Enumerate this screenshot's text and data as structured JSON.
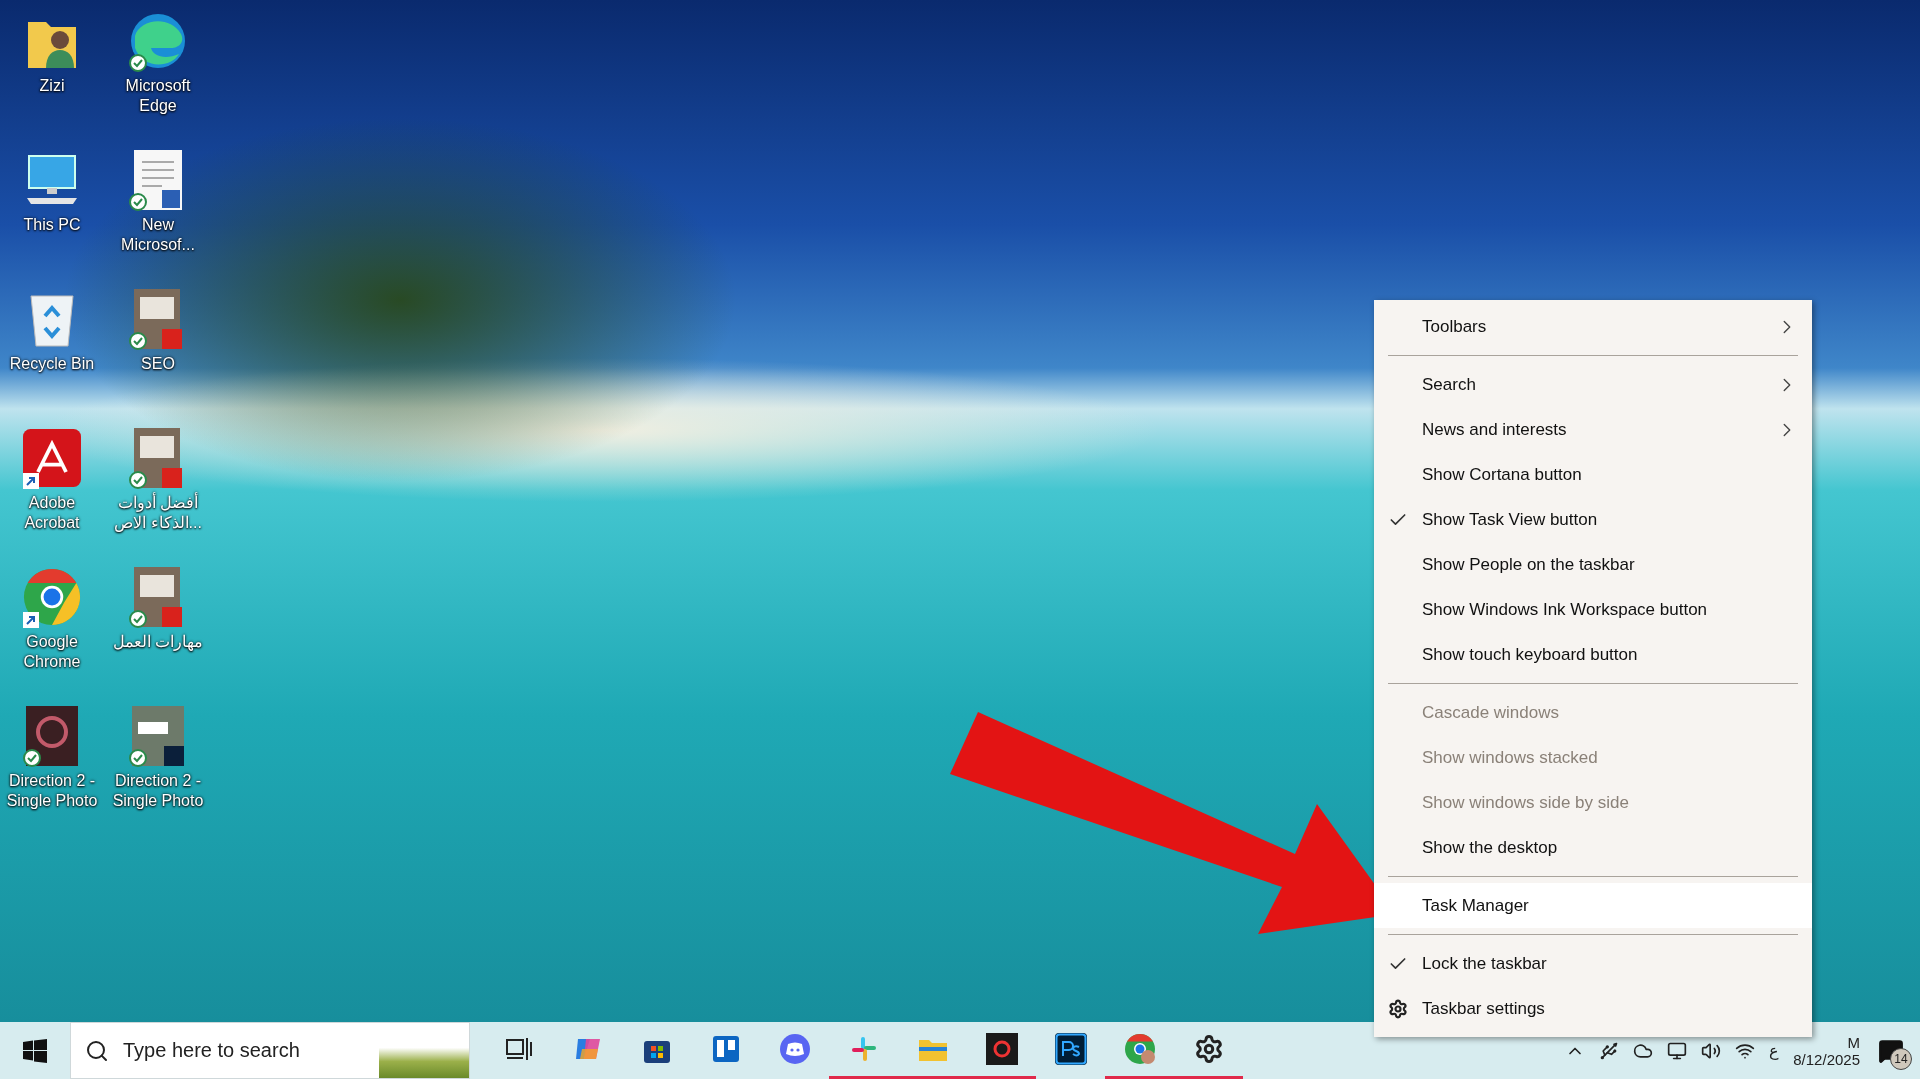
{
  "desktop_icons": [
    {
      "label": "Zizi",
      "kind": "user-folder",
      "synced": false,
      "shortcut": false
    },
    {
      "label": "Microsoft Edge",
      "kind": "edge",
      "synced": true,
      "shortcut": false
    },
    {
      "label": "This PC",
      "kind": "computer",
      "synced": false,
      "shortcut": false
    },
    {
      "label": "New Microsof...",
      "kind": "word-doc",
      "synced": true,
      "shortcut": false
    },
    {
      "label": "Recycle Bin",
      "kind": "recycle-bin",
      "synced": false,
      "shortcut": false
    },
    {
      "label": "SEO",
      "kind": "pdf",
      "synced": true,
      "shortcut": false
    },
    {
      "label": "Adobe Acrobat",
      "kind": "acrobat",
      "synced": false,
      "shortcut": true
    },
    {
      "label": "أفضل أدوات الذكاء الاص...",
      "kind": "pdf",
      "synced": true,
      "shortcut": false
    },
    {
      "label": "Google Chrome",
      "kind": "chrome",
      "synced": false,
      "shortcut": true
    },
    {
      "label": "مهارات العمل",
      "kind": "pdf",
      "synced": true,
      "shortcut": false
    },
    {
      "label": "Direction 2 - Single Photo",
      "kind": "photo",
      "synced": true,
      "shortcut": false
    },
    {
      "label": "Direction 2 - Single Photo",
      "kind": "photoshop",
      "synced": true,
      "shortcut": false
    }
  ],
  "context_menu": [
    {
      "kind": "item",
      "label": "Toolbars",
      "submenu": true,
      "checked": false,
      "disabled": false,
      "selected": false
    },
    {
      "kind": "separator"
    },
    {
      "kind": "item",
      "label": "Search",
      "submenu": true,
      "checked": false,
      "disabled": false,
      "selected": false
    },
    {
      "kind": "item",
      "label": "News and interests",
      "submenu": true,
      "checked": false,
      "disabled": false,
      "selected": false
    },
    {
      "kind": "item",
      "label": "Show Cortana button",
      "submenu": false,
      "checked": false,
      "disabled": false,
      "selected": false
    },
    {
      "kind": "item",
      "label": "Show Task View button",
      "submenu": false,
      "checked": true,
      "disabled": false,
      "selected": false
    },
    {
      "kind": "item",
      "label": "Show People on the taskbar",
      "submenu": false,
      "checked": false,
      "disabled": false,
      "selected": false
    },
    {
      "kind": "item",
      "label": "Show Windows Ink Workspace button",
      "submenu": false,
      "checked": false,
      "disabled": false,
      "selected": false
    },
    {
      "kind": "item",
      "label": "Show touch keyboard button",
      "submenu": false,
      "checked": false,
      "disabled": false,
      "selected": false
    },
    {
      "kind": "separator"
    },
    {
      "kind": "item",
      "label": "Cascade windows",
      "submenu": false,
      "checked": false,
      "disabled": true,
      "selected": false
    },
    {
      "kind": "item",
      "label": "Show windows stacked",
      "submenu": false,
      "checked": false,
      "disabled": true,
      "selected": false
    },
    {
      "kind": "item",
      "label": "Show windows side by side",
      "submenu": false,
      "checked": false,
      "disabled": true,
      "selected": false
    },
    {
      "kind": "item",
      "label": "Show the desktop",
      "submenu": false,
      "checked": false,
      "disabled": false,
      "selected": false
    },
    {
      "kind": "separator"
    },
    {
      "kind": "item",
      "label": "Task Manager",
      "submenu": false,
      "checked": false,
      "disabled": false,
      "selected": true
    },
    {
      "kind": "separator"
    },
    {
      "kind": "item",
      "label": "Lock the taskbar",
      "submenu": false,
      "checked": true,
      "disabled": false,
      "selected": false
    },
    {
      "kind": "settings",
      "label": "Taskbar settings",
      "submenu": false,
      "checked": false,
      "disabled": false,
      "selected": false
    }
  ],
  "taskbar": {
    "search": {
      "placeholder": "Type here to search"
    },
    "apps": [
      {
        "kind": "task-view",
        "running": false
      },
      {
        "kind": "copilot",
        "running": false
      },
      {
        "kind": "store",
        "running": false
      },
      {
        "kind": "trello",
        "running": false
      },
      {
        "kind": "discord",
        "running": false
      },
      {
        "kind": "slack",
        "running": true
      },
      {
        "kind": "explorer",
        "running": true
      },
      {
        "kind": "recorder",
        "running": true
      },
      {
        "kind": "photoshop",
        "running": false
      },
      {
        "kind": "chrome",
        "running": true
      },
      {
        "kind": "gear",
        "running": true
      }
    ],
    "tray": {
      "language": "ع",
      "time": "M",
      "date": "8/12/2025",
      "notifications": "14"
    }
  }
}
